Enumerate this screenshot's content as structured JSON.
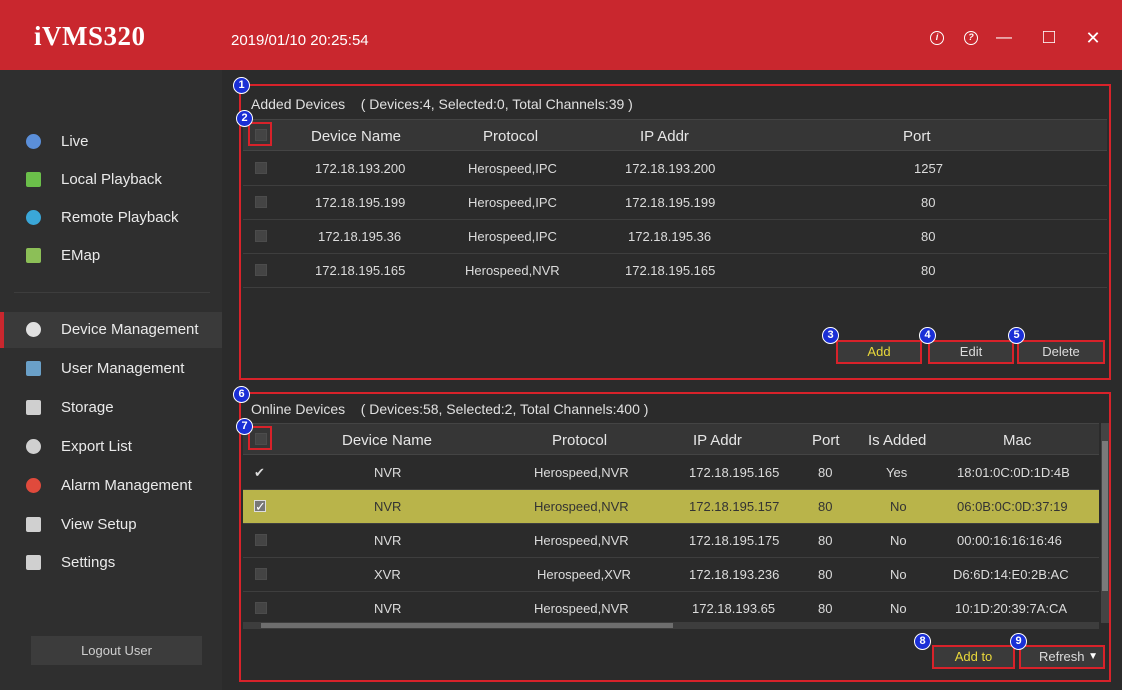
{
  "app": {
    "name": "iVMS320",
    "datetime": "2019/01/10 20:25:54"
  },
  "window_controls": {
    "info": "i",
    "help": "?",
    "minimize": "—",
    "maximize": "□",
    "close": "✕"
  },
  "sidebar": {
    "items": [
      {
        "label": "Live",
        "icon": "live-icon",
        "color": "#5b8fd9"
      },
      {
        "label": "Local Playback",
        "icon": "local-playback-icon",
        "color": "#6bbf4a"
      },
      {
        "label": "Remote Playback",
        "icon": "remote-playback-icon",
        "color": "#3aa7d8"
      },
      {
        "label": "EMap",
        "icon": "emap-icon",
        "color": "#8cbf57"
      },
      {
        "label": "Device Management",
        "icon": "device-management-icon",
        "color": "#e0e0e0",
        "active": true
      },
      {
        "label": "User Management",
        "icon": "user-management-icon",
        "color": "#6aa0c8"
      },
      {
        "label": "Storage",
        "icon": "storage-icon",
        "color": "#cfcfcf"
      },
      {
        "label": "Export List",
        "icon": "export-list-icon",
        "color": "#d0d0d0"
      },
      {
        "label": "Alarm Management",
        "icon": "alarm-icon",
        "color": "#e04a3c"
      },
      {
        "label": "View Setup",
        "icon": "view-setup-icon",
        "color": "#d0d0d0"
      },
      {
        "label": "Settings",
        "icon": "settings-icon",
        "color": "#d0d0d0"
      }
    ],
    "logout": "Logout User"
  },
  "added_devices": {
    "title": "Added Devices",
    "summary": "( Devices:4, Selected:0, Total Channels:39 )",
    "columns": [
      "Device Name",
      "Protocol",
      "IP Addr",
      "Port"
    ],
    "rows": [
      [
        "172.18.193.200",
        "Herospeed,IPC",
        "172.18.193.200",
        "1257"
      ],
      [
        "172.18.195.199",
        "Herospeed,IPC",
        "172.18.195.199",
        "80"
      ],
      [
        "172.18.195.36",
        "Herospeed,IPC",
        "172.18.195.36",
        "80"
      ],
      [
        "172.18.195.165",
        "Herospeed,NVR",
        "172.18.195.165",
        "80"
      ]
    ],
    "buttons": {
      "add": "Add",
      "edit": "Edit",
      "delete": "Delete"
    }
  },
  "online_devices": {
    "title": "Online Devices",
    "summary": "( Devices:58, Selected:2, Total Channels:400 )",
    "columns": [
      "Device Name",
      "Protocol",
      "IP Addr",
      "Port",
      "Is Added",
      "Mac"
    ],
    "rows": [
      [
        "NVR",
        "Herospeed,NVR",
        "172.18.195.165",
        "80",
        "Yes",
        "18:01:0C:0D:1D:4B"
      ],
      [
        "NVR",
        "Herospeed,NVR",
        "172.18.195.157",
        "80",
        "No",
        "06:0B:0C:0D:37:19"
      ],
      [
        "NVR",
        "Herospeed,NVR",
        "172.18.195.175",
        "80",
        "No",
        "00:00:16:16:16:46"
      ],
      [
        "XVR",
        "Herospeed,XVR",
        "172.18.193.236",
        "80",
        "No",
        "D6:6D:14:E0:2B:AC"
      ],
      [
        "NVR",
        "Herospeed,NVR",
        "172.18.193.65",
        "80",
        "No",
        "10:1D:20:39:7A:CA"
      ]
    ],
    "buttons": {
      "add_to": "Add to",
      "refresh": "Refresh"
    }
  },
  "callouts": [
    "1",
    "2",
    "3",
    "4",
    "5",
    "6",
    "7",
    "8",
    "9"
  ],
  "colors": {
    "title_bar": "#c9272e",
    "highlight_border": "#d8222a",
    "selected_row": "#b9b44a",
    "callout": "#1a2fd6",
    "button_accent_text": "#e9d83a"
  }
}
